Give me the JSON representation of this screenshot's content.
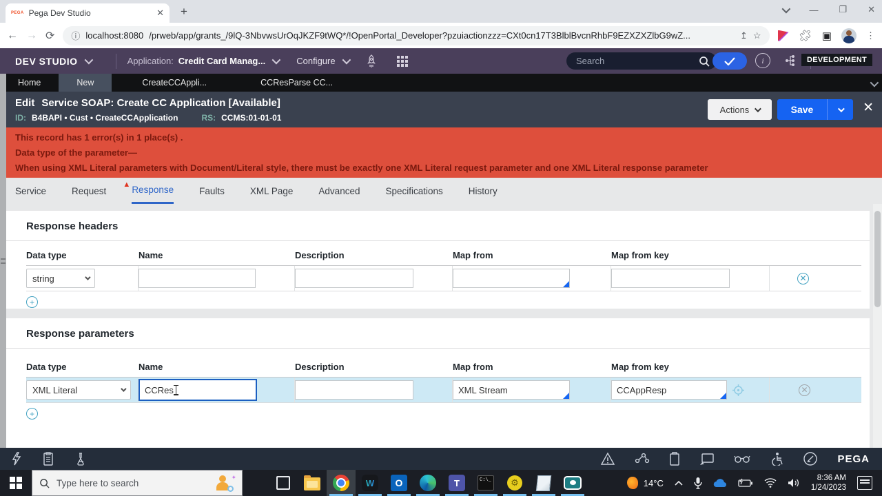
{
  "browser": {
    "tab_title": "Pega Dev Studio",
    "favicon_text": "PEGA",
    "url_host": "localhost:8080",
    "url_path": "/prweb/app/grants_/9lQ-3NbvwsUrOqJKZF9tWQ*/!OpenPortal_Developer?pzuiactionzzz=CXt0cn17T3BlblBvcnRhbF9EZXZXZlbG9wZ..."
  },
  "header": {
    "brand": "DEV STUDIO",
    "application_label": "Application:",
    "application_name": "Credit Card Manag...",
    "configure_label": "Configure",
    "search_placeholder": "Search",
    "environment_badge": "DEVELOPMENT"
  },
  "tab_bar": {
    "tabs": [
      {
        "label": "Home",
        "active": false
      },
      {
        "label": "New",
        "active": true
      },
      {
        "label": "CreateCCAppli...",
        "active": false
      },
      {
        "label": "CCResParse CC...",
        "active": false
      }
    ]
  },
  "record_header": {
    "title_prefix": "Edit",
    "title": "Service SOAP: Create CC Application [Available]",
    "id_label": "ID:",
    "id_value": "B4BAPI • Cust • CreateCCApplication",
    "rs_label": "RS:",
    "rs_value": "CCMS:01-01-01",
    "actions_label": "Actions",
    "save_label": "Save"
  },
  "error_banner": {
    "line1": "This record has 1 error(s) in 1 place(s) .",
    "line2": "Data type of the parameter—",
    "line3": "When using XML Literal parameters with Document/Literal style, there must be exactly one XML Literal request parameter and one XML Literal response parameter"
  },
  "nav_tabs": [
    "Service",
    "Request",
    "Response",
    "Faults",
    "XML Page",
    "Advanced",
    "Specifications",
    "History"
  ],
  "nav_active": "Response",
  "response_headers": {
    "title": "Response headers",
    "columns": [
      "Data type",
      "Name",
      "Description",
      "Map from",
      "Map from key"
    ],
    "row": {
      "data_type": "string",
      "name": "",
      "description": "",
      "map_from": "",
      "map_from_key": ""
    }
  },
  "response_parameters": {
    "title": "Response parameters",
    "columns": [
      "Data type",
      "Name",
      "Description",
      "Map from",
      "Map from key"
    ],
    "row": {
      "data_type": "XML Literal",
      "name": "CCRes",
      "description": "",
      "map_from": "XML Stream",
      "map_from_key": "CCAppResp"
    }
  },
  "footer_toolbar": {
    "brand": "PEGA"
  },
  "taskbar": {
    "search_placeholder": "Type here to search",
    "temperature": "14°C",
    "time": "8:36 AM",
    "date": "1/24/2023"
  },
  "icons": {
    "header": [
      "rocket-icon",
      "app-grid-icon",
      "search-icon",
      "check-icon",
      "info-icon",
      "hierarchy-icon"
    ],
    "footer_left": [
      "lightning-icon",
      "clipboard-list-icon",
      "flask-icon"
    ],
    "footer_right": [
      "alerts-icon",
      "tracer-icon",
      "clipboard-icon",
      "live-ui-icon",
      "ruleset-glasses-icon",
      "accessibility-icon",
      "performance-gauge-icon"
    ]
  }
}
